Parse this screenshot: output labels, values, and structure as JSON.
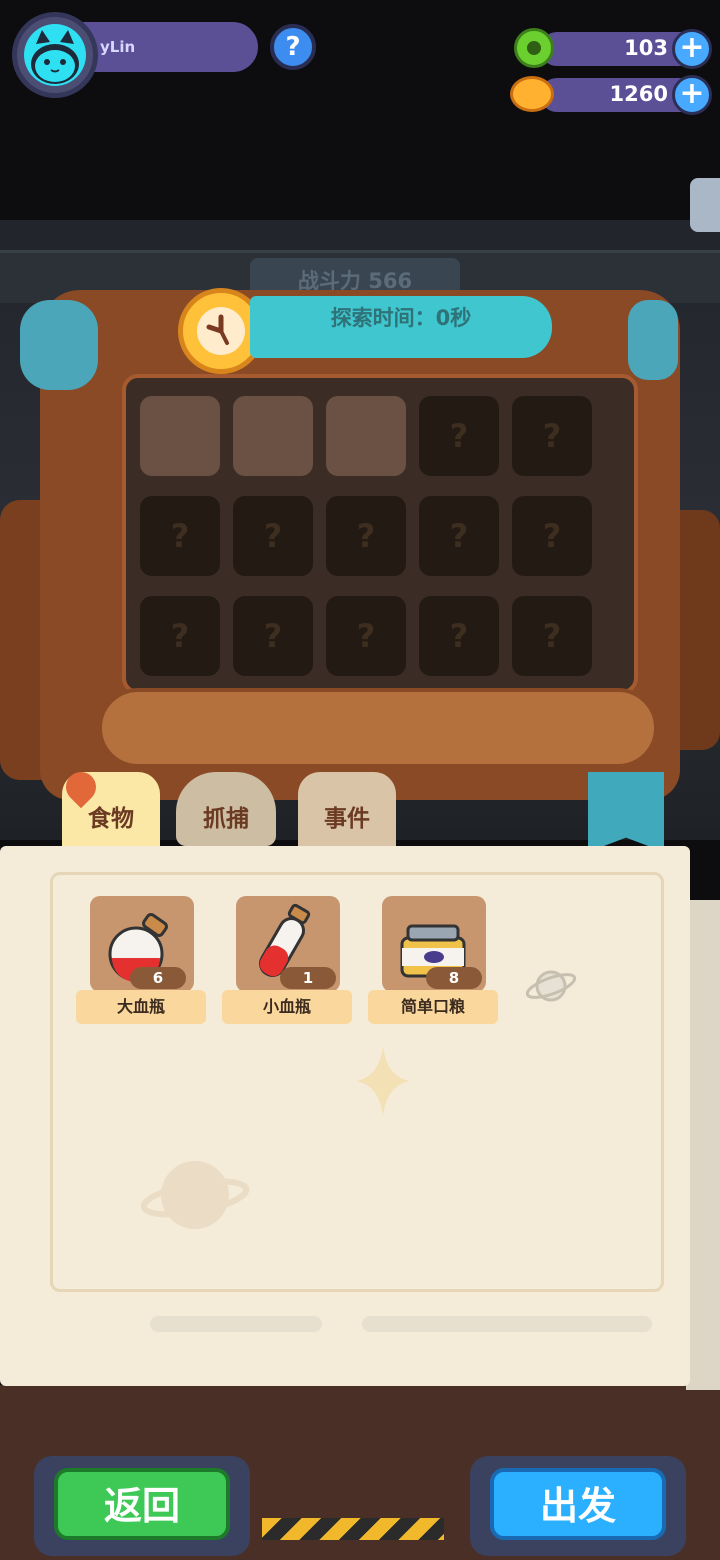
{
  "player": {
    "name": "yLin"
  },
  "help": {
    "symbol": "?"
  },
  "resources": [
    {
      "icon": "green-gem-icon",
      "value": "103",
      "add": "+"
    },
    {
      "icon": "planet-coin-icon",
      "value": "1260",
      "add": "+"
    }
  ],
  "scene": {
    "power_label": "战斗力 566"
  },
  "explore": {
    "time_label": "探索时间：0秒"
  },
  "grid": {
    "rows": 3,
    "cols": 5,
    "slots": [
      "empty",
      "empty",
      "empty",
      "unknown",
      "unknown",
      "unknown",
      "unknown",
      "unknown",
      "unknown",
      "unknown",
      "unknown",
      "unknown",
      "unknown",
      "unknown",
      "unknown"
    ],
    "unknown_symbol": "?"
  },
  "tabs": [
    {
      "label": "食物",
      "active": true
    },
    {
      "label": "抓捕",
      "active": false
    },
    {
      "label": "事件",
      "active": false
    }
  ],
  "items": [
    {
      "name": "大血瓶",
      "count": "6",
      "icon": "big-potion-icon"
    },
    {
      "name": "小血瓶",
      "count": "1",
      "icon": "small-potion-icon"
    },
    {
      "name": "简单口粮",
      "count": "8",
      "icon": "ration-can-icon"
    }
  ],
  "buttons": {
    "back": "返回",
    "go": "出发"
  },
  "colors": {
    "accent_teal": "#3fc6ce",
    "go_blue": "#2bb0ff",
    "back_green": "#3ec957"
  }
}
